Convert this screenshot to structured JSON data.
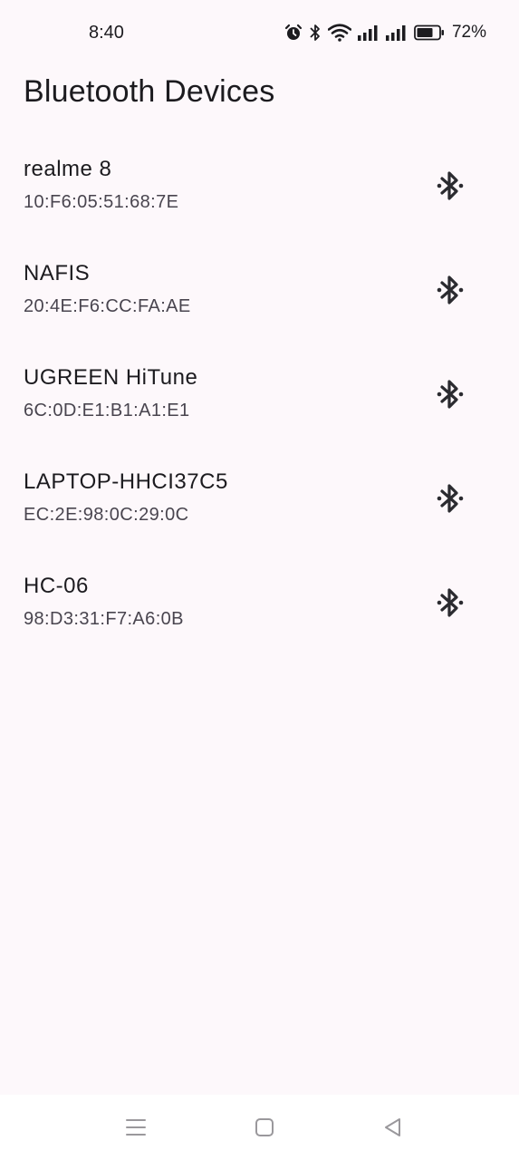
{
  "status_bar": {
    "time": "8:40",
    "battery_percent": "72%",
    "icons": [
      "alarm-icon",
      "bluetooth-icon",
      "wifi-icon",
      "signal-icon",
      "signal-icon",
      "battery-icon"
    ]
  },
  "page": {
    "title": "Bluetooth Devices"
  },
  "devices": [
    {
      "name": "realme 8",
      "address": "10:F6:05:51:68:7E",
      "icon": "bluetooth-icon"
    },
    {
      "name": "NAFIS",
      "address": "20:4E:F6:CC:FA:AE",
      "icon": "bluetooth-icon"
    },
    {
      "name": "UGREEN HiTune",
      "address": "6C:0D:E1:B1:A1:E1",
      "icon": "bluetooth-icon"
    },
    {
      "name": "LAPTOP-HHCI37C5",
      "address": "EC:2E:98:0C:29:0C",
      "icon": "bluetooth-icon"
    },
    {
      "name": "HC-06",
      "address": "98:D3:31:F7:A6:0B",
      "icon": "bluetooth-icon"
    }
  ],
  "nav_bar": {
    "buttons": [
      "menu-icon",
      "home-icon",
      "back-icon"
    ]
  },
  "colors": {
    "background": "#fdf8fb",
    "text_primary": "#1c1b1f",
    "text_secondary": "#49454f",
    "icon": "#2b2b30"
  }
}
